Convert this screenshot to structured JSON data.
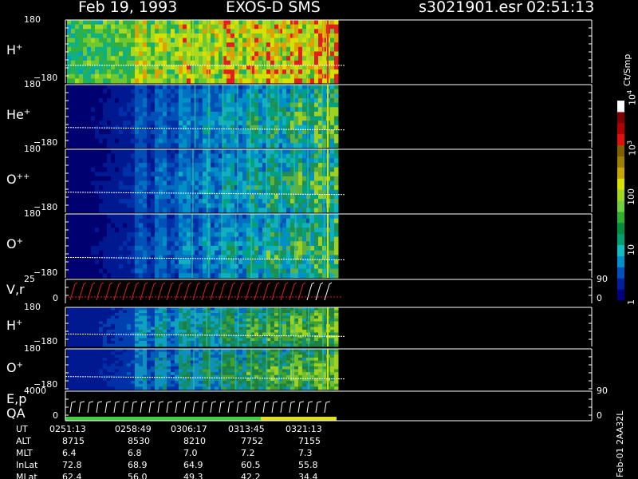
{
  "header": {
    "date": "Feb 19, 1993",
    "instrument": "EXOS-D SMS",
    "file": "s3021901.esr",
    "time": "02:51:13"
  },
  "panels": [
    {
      "label": "H",
      "sup": "+",
      "ymax": "180",
      "ymin": "−180",
      "kind": "spectro",
      "palette": "hot"
    },
    {
      "label": "He",
      "sup": "+",
      "ymax": "180",
      "ymin": "−180",
      "kind": "spectro",
      "palette": "cool"
    },
    {
      "label": "O",
      "sup": "++",
      "ymax": "180",
      "ymin": "−180",
      "kind": "spectro",
      "palette": "cool"
    },
    {
      "label": "O",
      "sup": "+",
      "ymax": "180",
      "ymin": "−180",
      "kind": "spectro",
      "palette": "cool"
    },
    {
      "label": "V,r",
      "sup": "",
      "ymax": "25",
      "ymin": "0",
      "kind": "line",
      "right_top": "90",
      "right_bot": "0"
    },
    {
      "label": "H",
      "sup": "+",
      "ymax": "180",
      "ymin": "−180",
      "kind": "spectro",
      "palette": "mid"
    },
    {
      "label": "O",
      "sup": "+",
      "ymax": "180",
      "ymin": "−180",
      "kind": "spectro",
      "palette": "warm"
    },
    {
      "label": "E,p",
      "label2": "QA",
      "sup": "",
      "ymax": "4000",
      "ymin": "0",
      "kind": "line2",
      "right_top": "90",
      "right_bot": "0"
    }
  ],
  "colorbar": {
    "unit": "Ct/Smp",
    "ticks": [
      {
        "label": "1",
        "frac": 0.0
      },
      {
        "label": "10",
        "frac": 0.25
      },
      {
        "label": "100",
        "frac": 0.5
      },
      {
        "label": "10",
        "sup": "3",
        "frac": 0.75
      },
      {
        "label": "10",
        "sup": "4",
        "frac": 1.0
      }
    ],
    "colors": [
      "#000080",
      "#0020a0",
      "#0050c0",
      "#0090d0",
      "#10c0c0",
      "#00a070",
      "#009040",
      "#30b030",
      "#70d040",
      "#a0d820",
      "#d8e000",
      "#c8a800",
      "#a08000",
      "#806000",
      "#e01010",
      "#b00000",
      "#800000",
      "#ffffff"
    ]
  },
  "chart_data": {
    "type": "heatmap",
    "title": "Feb 19, 1993  EXOS-D SMS",
    "x_ticks": [
      "0251:13",
      "0258:49",
      "0306:17",
      "0313:45",
      "0321:13"
    ],
    "panels_y_range": [
      -180,
      180
    ],
    "colorbar_range": [
      1,
      10000
    ],
    "colorbar_scale": "log",
    "vr_range": [
      0,
      25
    ],
    "ep_range": [
      0,
      4000
    ],
    "right_axis_range": [
      0,
      90
    ]
  },
  "ephemeris": {
    "footer_id": "Feb-01 2AA32L",
    "rows": [
      {
        "name": "UT",
        "values": [
          "0251:13",
          "0258:49",
          "0306:17",
          "0313:45",
          "0321:13"
        ]
      },
      {
        "name": "ALT",
        "values": [
          "8715",
          "8530",
          "8210",
          "7752",
          "7155"
        ]
      },
      {
        "name": "MLT",
        "values": [
          "6.4",
          "6.8",
          "7.0",
          "7.2",
          "7.3"
        ]
      },
      {
        "name": "InLat",
        "values": [
          "72.8",
          "68.9",
          "64.9",
          "60.5",
          "55.8"
        ]
      },
      {
        "name": "MLat",
        "values": [
          "62.4",
          "56.0",
          "49.3",
          "42.2",
          "34.4"
        ]
      }
    ]
  }
}
